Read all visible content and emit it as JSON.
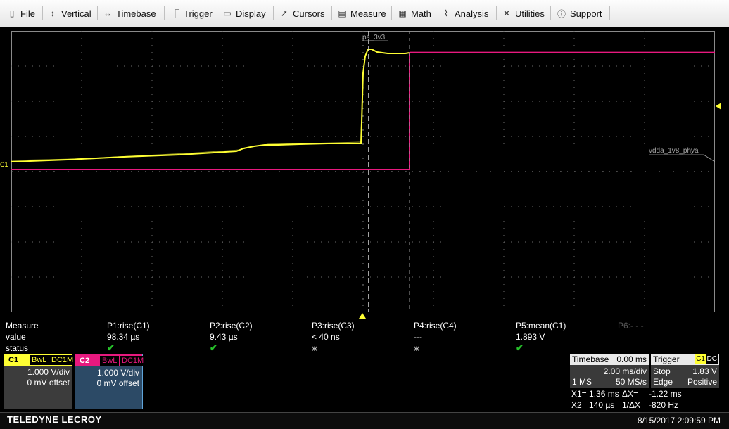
{
  "menu": {
    "items": [
      {
        "label": "File",
        "icon": "file-icon",
        "glyph": "▯"
      },
      {
        "label": "Vertical",
        "icon": "vertical-arrows-icon",
        "glyph": "↕"
      },
      {
        "label": "Timebase",
        "icon": "horizontal-arrows-icon",
        "glyph": "↔"
      },
      {
        "label": "Trigger",
        "icon": "trigger-icon",
        "glyph": "⎾"
      },
      {
        "label": "Display",
        "icon": "display-icon",
        "glyph": "▭"
      },
      {
        "label": "Cursors",
        "icon": "cursor-arrow-icon",
        "glyph": "➚"
      },
      {
        "label": "Measure",
        "icon": "measure-icon",
        "glyph": "▤"
      },
      {
        "label": "Math",
        "icon": "calculator-icon",
        "glyph": "▦"
      },
      {
        "label": "Analysis",
        "icon": "analysis-chart-icon",
        "glyph": "⌇"
      },
      {
        "label": "Utilities",
        "icon": "wrench-icon",
        "glyph": "✕"
      },
      {
        "label": "Support",
        "icon": "info-icon",
        "glyph": "ⓘ"
      }
    ]
  },
  "grid": {
    "trace_labels": {
      "c1_marker": "C1",
      "ps_3v3": "ps_3v3",
      "vdda": "vdda_1v8_phya"
    },
    "colors": {
      "c1": "#ffff33",
      "c2": "#e8197f",
      "grid": "#6a6a6a",
      "cursor": "#d8d8d8"
    }
  },
  "measure": {
    "row_labels": {
      "measure": "Measure",
      "value": "value",
      "status": "status"
    },
    "params": [
      {
        "name": "P1:rise(C1)",
        "value": "98.34 µs",
        "status": "ok",
        "status_glyph": "✔"
      },
      {
        "name": "P2:rise(C2)",
        "value": "9.43 µs",
        "status": "ok",
        "status_glyph": "✔"
      },
      {
        "name": "P3:rise(C3)",
        "value": "< 40 ns",
        "status": "bad",
        "status_glyph": "ж"
      },
      {
        "name": "P4:rise(C4)",
        "value": "---",
        "status": "bad",
        "status_glyph": "ж"
      },
      {
        "name": "P5:mean(C1)",
        "value": "1.893 V",
        "status": "ok",
        "status_glyph": "✔"
      },
      {
        "name": "P6:- - -",
        "value": "",
        "status": "",
        "status_glyph": ""
      }
    ]
  },
  "channels": [
    {
      "name": "C1",
      "bw": "BwL",
      "coupling": "DC1M",
      "vdiv": "1.000 V/div",
      "offset": "0 mV offset",
      "color": "#ffff33"
    },
    {
      "name": "C2",
      "bw": "BwL",
      "coupling": "DC1M",
      "vdiv": "1.000 V/div",
      "offset": "0 mV offset",
      "color": "#e8197f"
    }
  ],
  "timebase": {
    "title": "Timebase",
    "delay": "0.00 ms",
    "tdiv": "2.00 ms/div",
    "samples": "1 MS",
    "rate": "50 MS/s"
  },
  "trigger": {
    "title": "Trigger",
    "source": "C1",
    "coupling": "DC",
    "mode": "Stop",
    "level": "1.83 V",
    "type": "Edge",
    "slope": "Positive"
  },
  "cursors": {
    "x1": "X1= 1.36 ms",
    "dx": "ΔX=",
    "dx_value": "-1.22 ms",
    "x2": "X2= 140 µs",
    "inv_dx": "1/ΔX=",
    "inv_dx_value": "-820 Hz"
  },
  "footer": {
    "brand": "TELEDYNE LECROY",
    "datetime": "8/15/2017 2:09:59 PM"
  }
}
